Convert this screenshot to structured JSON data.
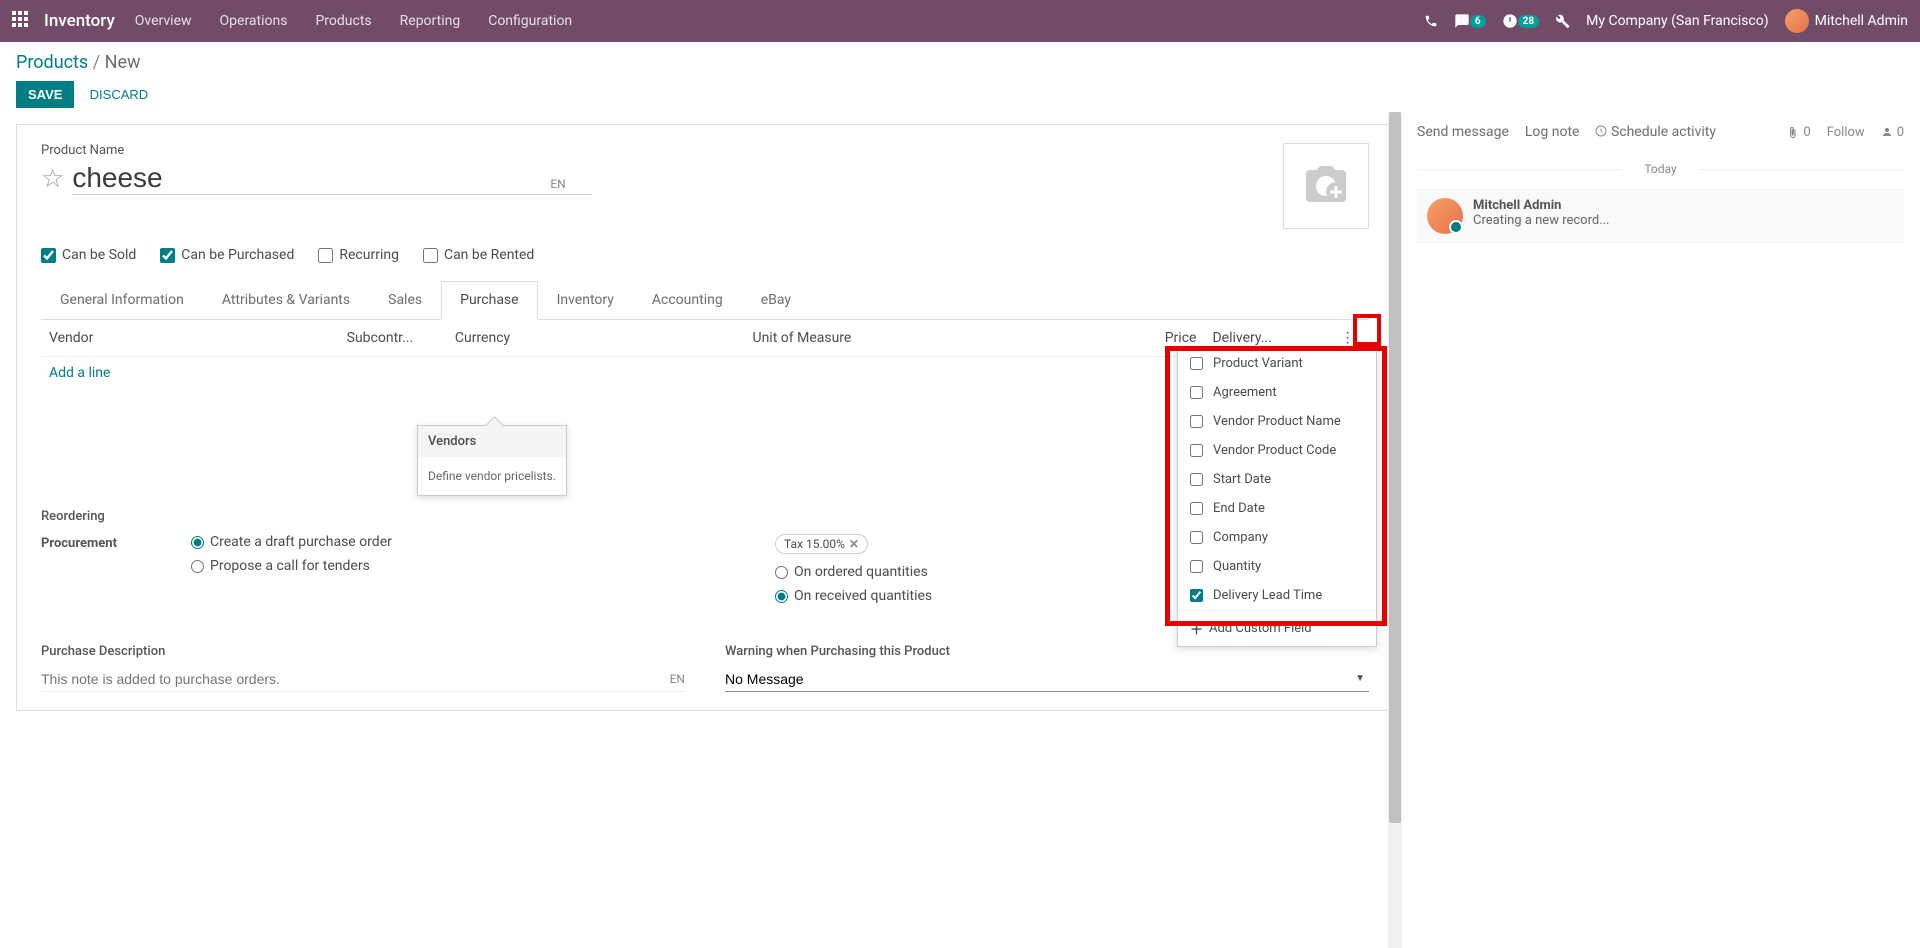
{
  "navbar": {
    "brand": "Inventory",
    "menu": [
      "Overview",
      "Operations",
      "Products",
      "Reporting",
      "Configuration"
    ],
    "messages_badge": "6",
    "activities_badge": "28",
    "company": "My Company (San Francisco)",
    "user": "Mitchell Admin"
  },
  "breadcrumb": {
    "root": "Products",
    "sep": "/",
    "current": "New"
  },
  "actions": {
    "save": "SAVE",
    "discard": "DISCARD"
  },
  "product": {
    "name_label": "Product Name",
    "name_value": "cheese",
    "lang": "EN",
    "flags": {
      "can_be_sold": {
        "label": "Can be Sold",
        "checked": true
      },
      "can_be_purchased": {
        "label": "Can be Purchased",
        "checked": true
      },
      "recurring": {
        "label": "Recurring",
        "checked": false
      },
      "can_be_rented": {
        "label": "Can be Rented",
        "checked": false
      }
    }
  },
  "tabs": [
    "General Information",
    "Attributes & Variants",
    "Sales",
    "Purchase",
    "Inventory",
    "Accounting",
    "eBay"
  ],
  "active_tab": "Purchase",
  "vendor_table": {
    "columns": [
      "Vendor",
      "Subcontr...",
      "Currency",
      "Unit of Measure",
      "Price",
      "Delivery..."
    ],
    "add_line": "Add a line"
  },
  "columns_menu": {
    "items": [
      {
        "label": "Product Variant",
        "checked": false
      },
      {
        "label": "Agreement",
        "checked": false
      },
      {
        "label": "Vendor Product Name",
        "checked": false
      },
      {
        "label": "Vendor Product Code",
        "checked": false
      },
      {
        "label": "Start Date",
        "checked": false
      },
      {
        "label": "End Date",
        "checked": false
      },
      {
        "label": "Company",
        "checked": false
      },
      {
        "label": "Quantity",
        "checked": false
      },
      {
        "label": "Delivery Lead Time",
        "checked": true
      }
    ],
    "add_custom": "Add Custom Field"
  },
  "tooltip": {
    "title": "Vendors",
    "body": "Define vendor pricelists."
  },
  "reordering": {
    "heading": "Reordering",
    "procurement_label": "Procurement",
    "procurement_options": [
      "Create a draft purchase order",
      "Propose a call for tenders"
    ],
    "procurement_selected": 0,
    "tax_tag": "Tax 15.00%",
    "policy_options": [
      "On ordered quantities",
      "On received quantities"
    ],
    "policy_selected": 1,
    "policy_suffix_visible": "y"
  },
  "purchase_desc": {
    "heading": "Purchase Description",
    "placeholder": "This note is added to purchase orders.",
    "lang": "EN",
    "warning_heading": "Warning when Purchasing this Product",
    "warning_value": "No Message"
  },
  "chatter": {
    "send": "Send message",
    "log": "Log note",
    "schedule": "Schedule activity",
    "attach_count": "0",
    "follow": "Follow",
    "follower_count": "0",
    "today": "Today",
    "msg_author": "Mitchell Admin",
    "msg_text": "Creating a new record..."
  }
}
